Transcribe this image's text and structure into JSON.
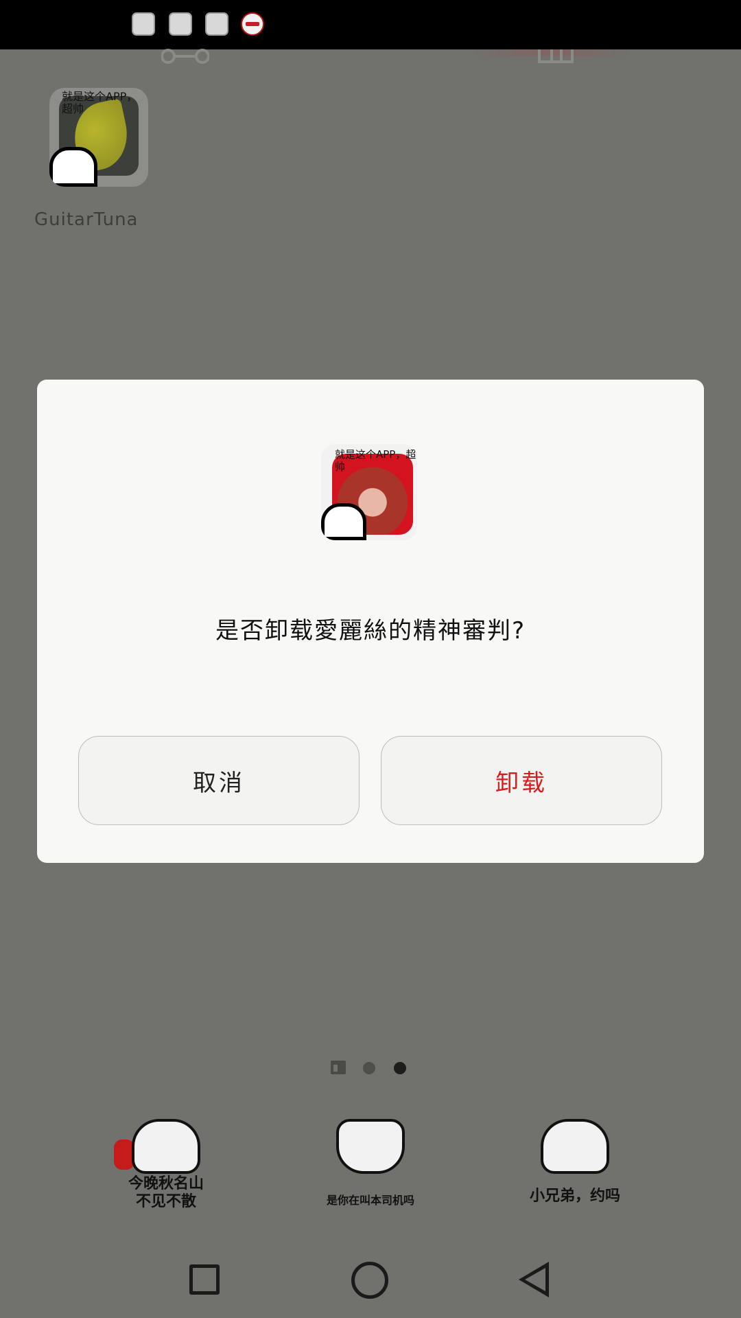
{
  "status_bar": {
    "icons": [
      "app-notification-icon",
      "panda-notification-icon",
      "meme-notification-icon",
      "red-badge-notification-icon"
    ]
  },
  "home": {
    "app": {
      "label": "GuitarTuna",
      "overlay_text": "就是这个APP，超帅"
    }
  },
  "dialog": {
    "icon_overlay_text": "就是这个APP，超帅",
    "message": "是否卸载愛麗絲的精神審判?",
    "cancel_label": "取消",
    "uninstall_label": "卸载",
    "uninstall_color": "#d81c1c"
  },
  "dock": {
    "items": [
      {
        "caption": "今晚秋名山\n不见不散"
      },
      {
        "caption": "是你在叫本司机吗"
      },
      {
        "caption": "小兄弟，约吗"
      }
    ]
  },
  "navigation": {
    "recent_label": "",
    "home_label": "",
    "back_label": ""
  }
}
